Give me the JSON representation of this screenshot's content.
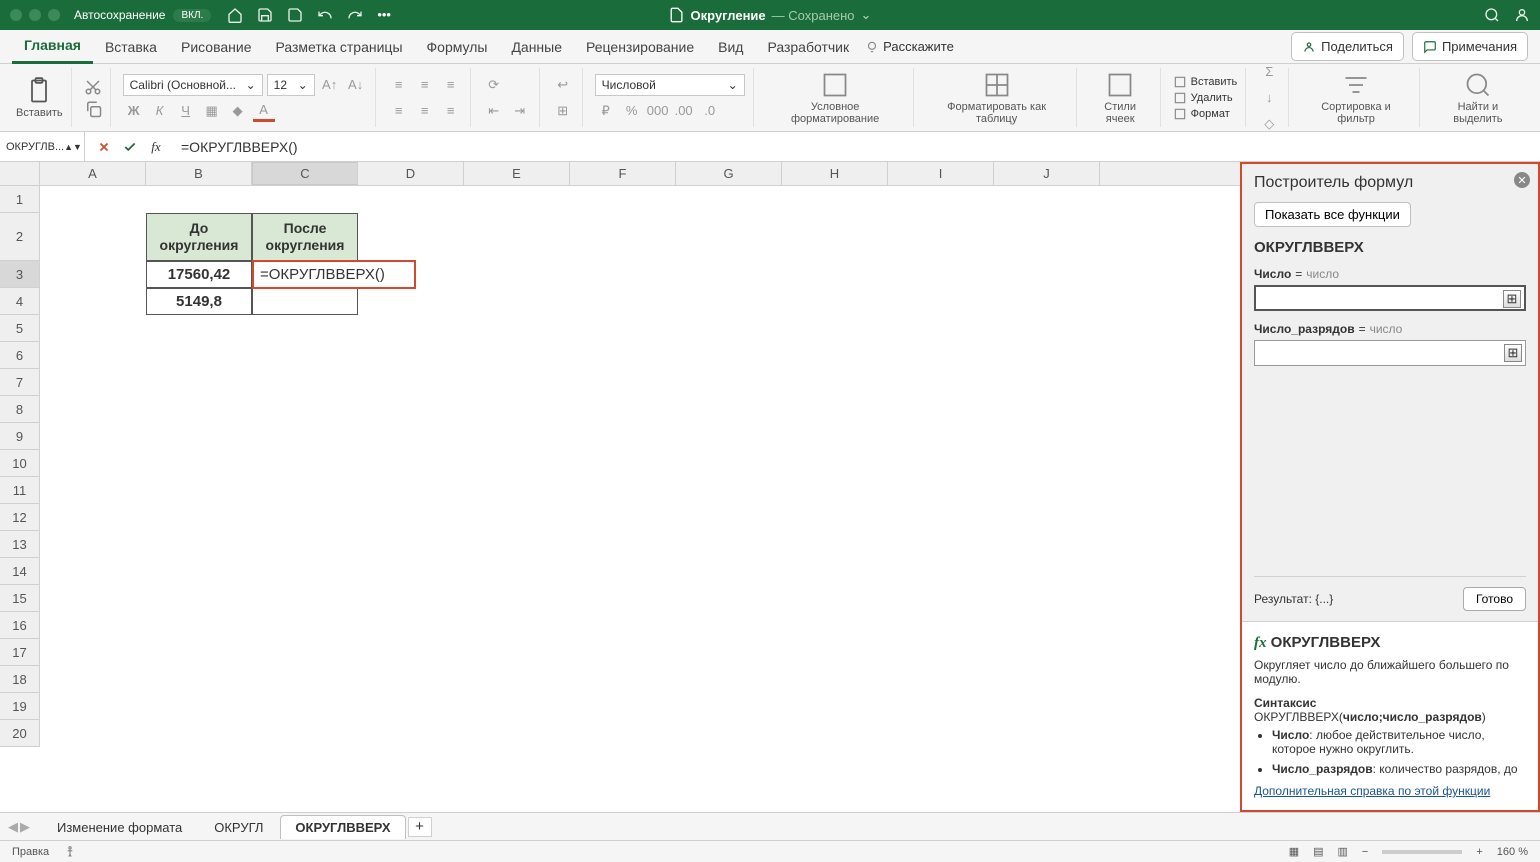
{
  "title": {
    "autosave": "Автосохранение",
    "autostate": "ВКЛ.",
    "doc": "Округление",
    "saved": "— Сохранено"
  },
  "tabs": [
    "Главная",
    "Вставка",
    "Рисование",
    "Разметка страницы",
    "Формулы",
    "Данные",
    "Рецензирование",
    "Вид",
    "Разработчик"
  ],
  "tellme": "Расскажите",
  "share": "Поделиться",
  "comments": "Примечания",
  "ribbon": {
    "paste": "Вставить",
    "font": "Calibri (Основной...",
    "size": "12",
    "numfmt": "Числовой",
    "cond": "Условное форматирование",
    "table": "Форматировать как таблицу",
    "styles": "Стили ячеек",
    "insert": "Вставить",
    "delete": "Удалить",
    "format": "Формат",
    "sort": "Сортировка и фильтр",
    "find": "Найти и выделить"
  },
  "namebox": "ОКРУГЛВ...",
  "formula": "=ОКРУГЛВВЕРХ()",
  "cols": [
    "A",
    "B",
    "C",
    "D",
    "E",
    "F",
    "G",
    "H",
    "I",
    "J"
  ],
  "rows": [
    "1",
    "2",
    "3",
    "4",
    "5",
    "6",
    "7",
    "8",
    "9",
    "10",
    "11",
    "12",
    "13",
    "14",
    "15",
    "16",
    "17",
    "18",
    "19",
    "20"
  ],
  "dataTable": {
    "h1": "До округления",
    "h2": "После округления",
    "r1c1": "17560,42",
    "r1c2": "=ОКРУГЛВВЕРХ()",
    "r2c1": "5149,8"
  },
  "panel": {
    "title": "Построитель формул",
    "showall": "Показать все функции",
    "fn": "ОКРУГЛВВЕРХ",
    "arg1": "Число",
    "arg2": "Число_разрядов",
    "hint": "число",
    "result": "Результат: {...}",
    "done": "Готово"
  },
  "help": {
    "title": "ОКРУГЛВВЕРХ",
    "desc": "Округляет число до ближайшего большего по модулю.",
    "syntax": "Синтаксис",
    "sig": "ОКРУГЛВВЕРХ(",
    "sigb": "число;число_разрядов",
    "sigc": ")",
    "b1": "Число",
    "b1t": ": любое действительное число, которое нужно округлить.",
    "b2": "Число_разрядов",
    "b2t": ": количество разрядов, до",
    "link": "Дополнительная справка по этой функции"
  },
  "sheetTabs": [
    "Изменение формата",
    "ОКРУГЛ",
    "ОКРУГЛВВЕРХ"
  ],
  "status": {
    "mode": "Правка",
    "zoom": "160 %"
  }
}
